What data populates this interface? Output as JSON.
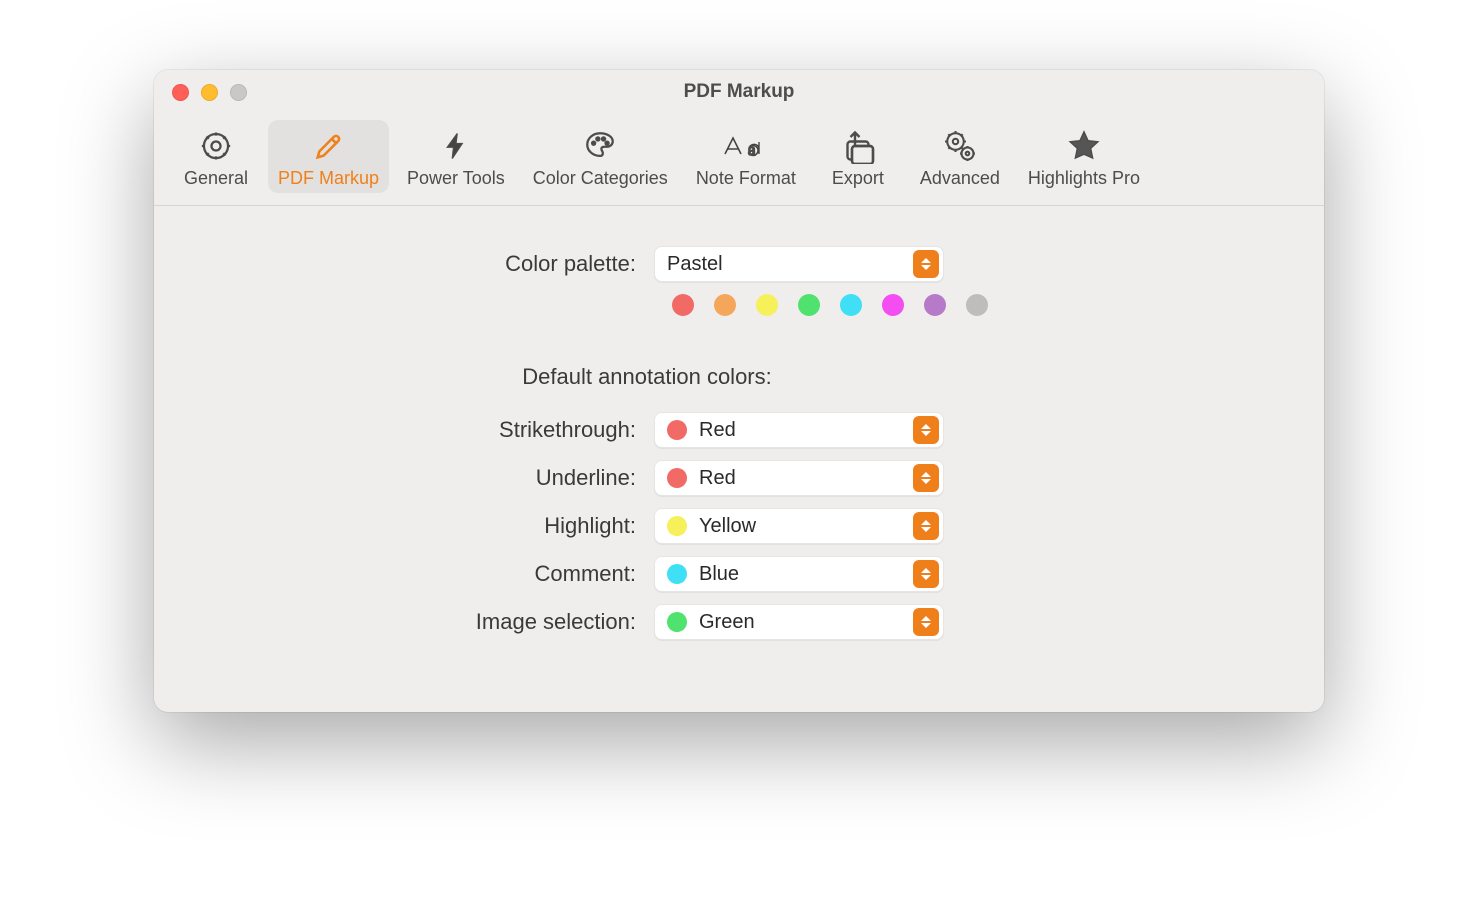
{
  "window": {
    "title": "PDF Markup"
  },
  "tabs": [
    {
      "id": "general",
      "label": "General"
    },
    {
      "id": "pdf-markup",
      "label": "PDF Markup"
    },
    {
      "id": "power-tools",
      "label": "Power Tools"
    },
    {
      "id": "color-categories",
      "label": "Color Categories"
    },
    {
      "id": "note-format",
      "label": "Note Format"
    },
    {
      "id": "export",
      "label": "Export"
    },
    {
      "id": "advanced",
      "label": "Advanced"
    },
    {
      "id": "highlights-pro",
      "label": "Highlights Pro"
    }
  ],
  "palette": {
    "label": "Color palette:",
    "value": "Pastel",
    "colors": [
      "#f26a66",
      "#f5a65b",
      "#f6f05a",
      "#4fe26e",
      "#3fe0f5",
      "#f44df2",
      "#b67ac9",
      "#bdbdbd"
    ]
  },
  "section_title": "Default annotation colors:",
  "defaults": {
    "strikethrough": {
      "label": "Strikethrough:",
      "value": "Red",
      "color": "#f26a66"
    },
    "underline": {
      "label": "Underline:",
      "value": "Red",
      "color": "#f26a66"
    },
    "highlight": {
      "label": "Highlight:",
      "value": "Yellow",
      "color": "#f6f05a"
    },
    "comment": {
      "label": "Comment:",
      "value": "Blue",
      "color": "#3fe0f5"
    },
    "image": {
      "label": "Image selection:",
      "value": "Green",
      "color": "#4fe26e"
    }
  }
}
